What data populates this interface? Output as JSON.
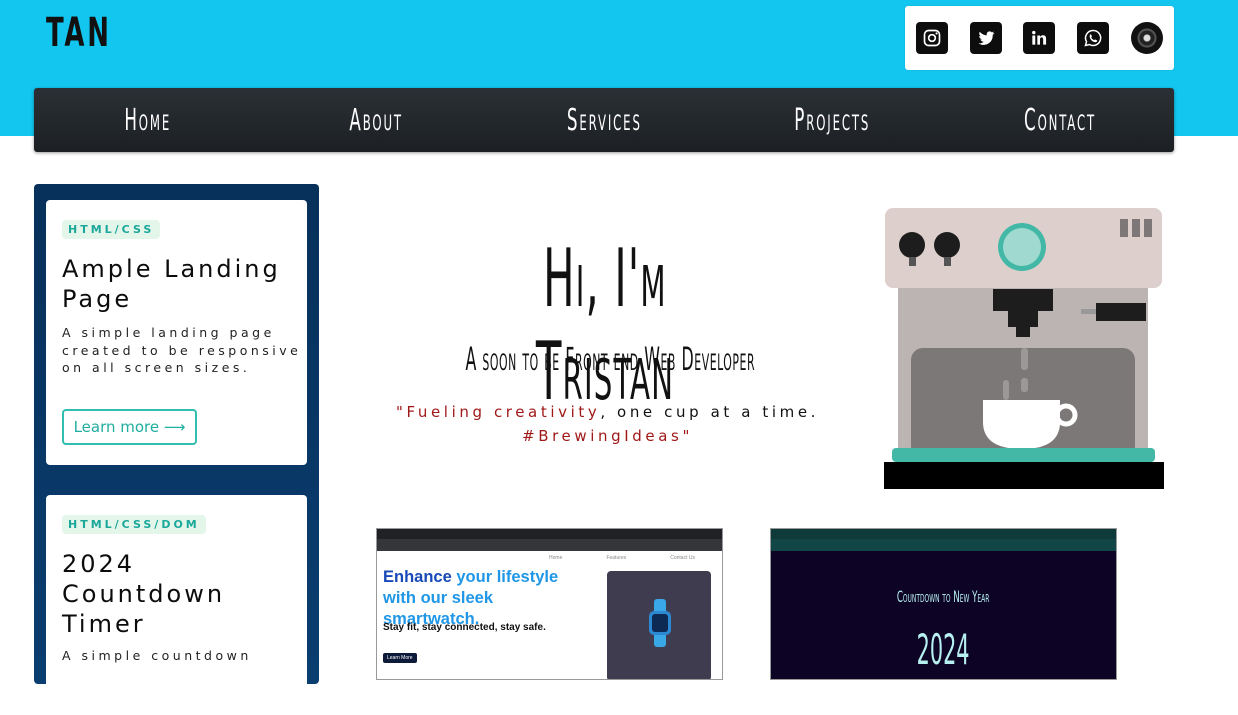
{
  "brand": {
    "logo": "TAN"
  },
  "social": {
    "icons": [
      "instagram-icon",
      "twitter-icon",
      "linkedin-icon",
      "whatsapp-icon",
      "vinyl-record-icon"
    ]
  },
  "nav": {
    "items": [
      "Home",
      "About",
      "Services",
      "Projects",
      "Contact"
    ]
  },
  "sidebar": {
    "cards": [
      {
        "tag": "HTML/CSS",
        "title": "Ample Landing Page",
        "description": "A simple landing page created to be responsive on all screen sizes.",
        "button": "Learn more ⟶"
      },
      {
        "tag": "HTML/CSS/DOM",
        "title": "2024 Countdown Timer",
        "description": "A simple countdown"
      }
    ]
  },
  "hero": {
    "title": "Hi, I'm Tristan",
    "subtitle": "A soon to be Front end Web Developer",
    "quote_open": "\"",
    "quote_red_1": "Fueling creativity",
    "quote_black": ", one cup at a time.",
    "quote_red_2": "#BrewingIdeas",
    "quote_close": "\""
  },
  "projects": {
    "landing_preview": {
      "headline_1": "Enhance ",
      "headline_hl": "your lifestyle with our sleek smartwatch.",
      "tagline": "Stay fit, stay connected, stay safe.",
      "cta": "Learn More",
      "nav": [
        "Home",
        "Features",
        "Contact Us"
      ]
    },
    "countdown_preview": {
      "title": "Countdown to New Year",
      "year": "2024"
    }
  },
  "colors": {
    "header_bg": "#12c6f0",
    "nav_bg": "#2b3035",
    "sidebar_bg": "#07305a",
    "accent_teal": "#30bfae",
    "quote_red": "#a01818"
  }
}
